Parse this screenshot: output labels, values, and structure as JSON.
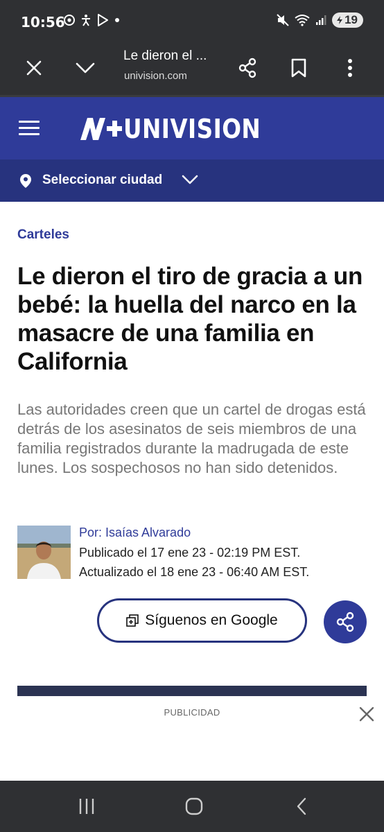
{
  "status_bar": {
    "time": "10:56",
    "battery": "19",
    "left_icons": [
      "chrome-icon",
      "accessibility-icon",
      "play-store-icon",
      "dot-icon"
    ],
    "right_icons": [
      "mute-icon",
      "wifi-icon",
      "signal-icon",
      "battery-icon"
    ]
  },
  "browser": {
    "title": "Le dieron el ...",
    "url": "univision.com"
  },
  "site": {
    "logo_text": "UNIVISION",
    "city_selector": "Seleccionar ciudad",
    "brand_color": "#2f3b99"
  },
  "article": {
    "category": "Carteles",
    "headline": "Le dieron el tiro de gracia a un bebé: la huella del narco en la masacre de una familia en California",
    "summary": "Las autoridades creen que un cartel de drogas está detrás de los asesinatos de seis miembros de una familia registrados durante la madrugada de este lunes. Los sospechosos no han sido detenidos.",
    "author": "Por: Isaías Alvarado",
    "published": "Publicado el 17 ene 23 - 02:19 PM EST.",
    "updated": "Actualizado el 18 ene 23 - 06:40 AM EST.",
    "follow_button": "Síguenos en Google"
  },
  "ad": {
    "label": "PUBLICIDAD"
  }
}
